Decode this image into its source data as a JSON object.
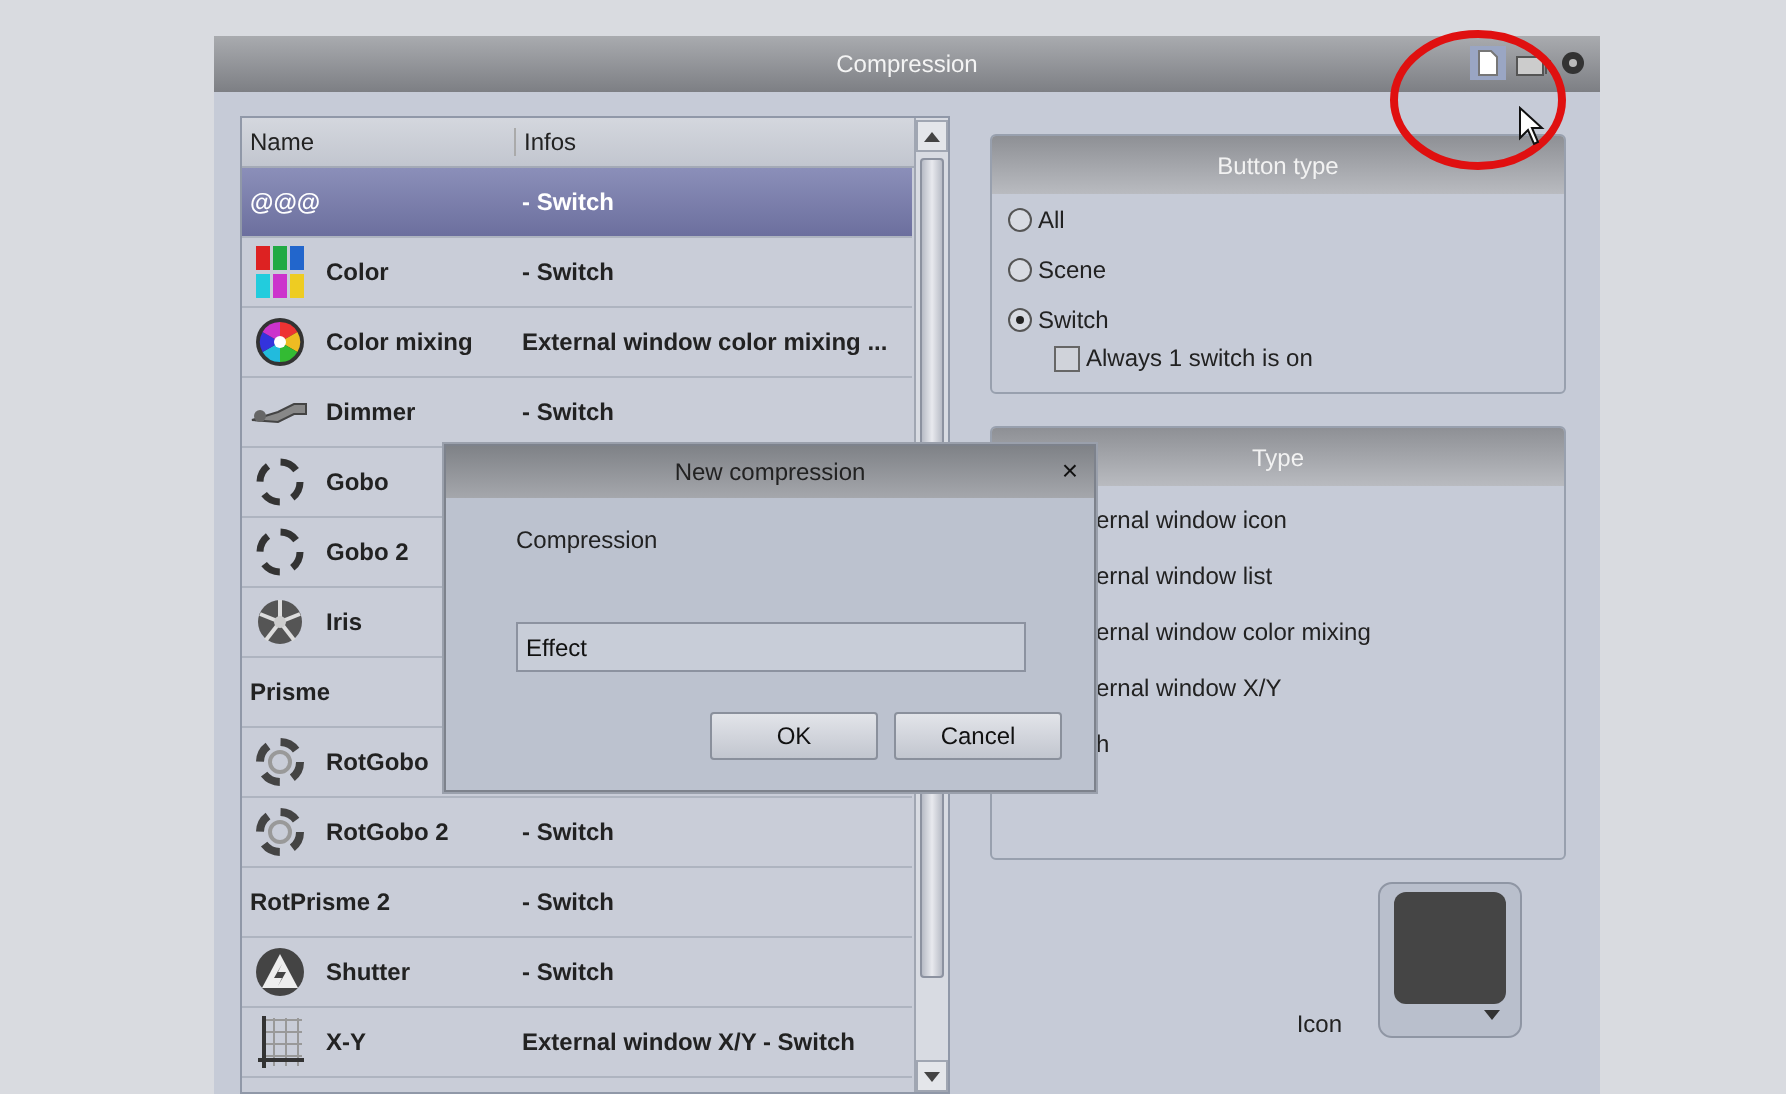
{
  "window": {
    "title": "Compression"
  },
  "list": {
    "columns": [
      "Name",
      "Infos"
    ],
    "rows": [
      {
        "name": "@@@",
        "info": "- Switch",
        "kind": "plain",
        "selected": true
      },
      {
        "name": "Color",
        "info": "- Switch",
        "kind": "swatches",
        "selected": false
      },
      {
        "name": "Color mixing",
        "info": "External window color mixing ...",
        "kind": "wheel",
        "selected": false
      },
      {
        "name": "Dimmer",
        "info": "- Switch",
        "kind": "dimmer",
        "selected": false
      },
      {
        "name": "Gobo",
        "kind": "gobo",
        "selected": false
      },
      {
        "name": "Gobo 2",
        "kind": "gobo",
        "selected": false
      },
      {
        "name": "Iris",
        "kind": "iris",
        "selected": false
      },
      {
        "name": "Prisme",
        "kind": "plain",
        "selected": false
      },
      {
        "name": "RotGobo",
        "kind": "rotgobo",
        "selected": false
      },
      {
        "name": "RotGobo 2",
        "info": "- Switch",
        "kind": "rotgobo",
        "selected": false
      },
      {
        "name": "RotPrisme 2",
        "info": "- Switch",
        "kind": "plain",
        "selected": false
      },
      {
        "name": "Shutter",
        "info": "- Switch",
        "kind": "shutter",
        "selected": false
      },
      {
        "name": "X-Y",
        "info": "External window X/Y - Switch",
        "kind": "xy",
        "selected": false
      }
    ]
  },
  "button_type": {
    "title": "Button type",
    "options": [
      {
        "label": "All",
        "selected": false
      },
      {
        "label": "Scene",
        "selected": false
      },
      {
        "label": "Switch",
        "selected": true
      }
    ],
    "checkbox": {
      "label": "Always 1 switch is on",
      "checked": false
    }
  },
  "type_panel": {
    "title": "Type",
    "items": [
      "ernal window icon",
      "ernal window list",
      "ernal window color mixing",
      "ernal window X/Y",
      "h"
    ]
  },
  "icon_field": {
    "label": "Icon"
  },
  "dialog": {
    "title": "New compression",
    "close": "×",
    "label": "Compression",
    "value": "Effect",
    "buttons": [
      "OK",
      "Cancel"
    ]
  }
}
